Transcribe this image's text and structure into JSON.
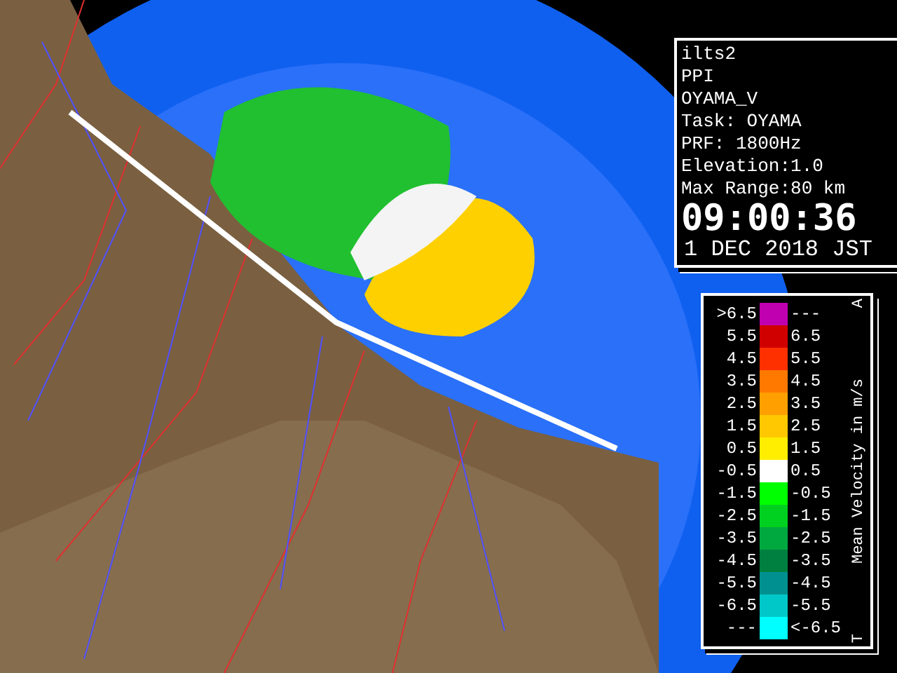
{
  "info_panel": {
    "lines": [
      "ilts2",
      "PPI",
      "OYAMA_V",
      "Task: OYAMA",
      "PRF: 1800Hz",
      "Elevation:1.0",
      "Max Range:80 km"
    ],
    "time": "09:00:36",
    "date": "1 DEC 2018 JST"
  },
  "legend": {
    "title": "Mean Velocity in m/s",
    "top_mark": "A",
    "bottom_mark": "T",
    "rows": [
      {
        "low": ">6.5",
        "high": "---",
        "color": "#c000b0"
      },
      {
        "low": "5.5",
        "high": "6.5",
        "color": "#d00000"
      },
      {
        "low": "4.5",
        "high": "5.5",
        "color": "#ff3000"
      },
      {
        "low": "3.5",
        "high": "4.5",
        "color": "#ff7800"
      },
      {
        "low": "2.5",
        "high": "3.5",
        "color": "#ffa000"
      },
      {
        "low": "1.5",
        "high": "2.5",
        "color": "#ffc800"
      },
      {
        "low": "0.5",
        "high": "1.5",
        "color": "#ffee00"
      },
      {
        "low": "-0.5",
        "high": "0.5",
        "color": "#ffffff"
      },
      {
        "low": "-1.5",
        "high": "-0.5",
        "color": "#00ff00"
      },
      {
        "low": "-2.5",
        "high": "-1.5",
        "color": "#00d020"
      },
      {
        "low": "-3.5",
        "high": "-2.5",
        "color": "#00a840"
      },
      {
        "low": "-4.5",
        "high": "-3.5",
        "color": "#008040"
      },
      {
        "low": "-5.5",
        "high": "-4.5",
        "color": "#009090"
      },
      {
        "low": "-6.5",
        "high": "-5.5",
        "color": "#00c8c8"
      },
      {
        "low": "---",
        "high": "<-6.5",
        "color": "#00ffff"
      }
    ]
  }
}
